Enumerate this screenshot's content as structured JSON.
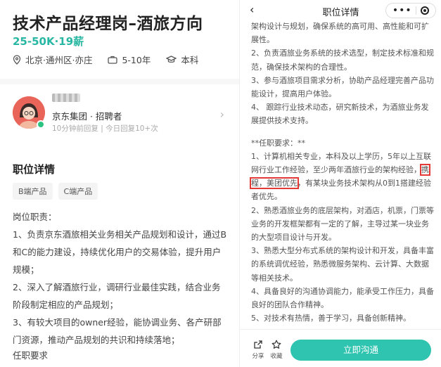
{
  "left": {
    "title": "技术产品经理岗–酒旅方向",
    "salary": "25-50K·19薪",
    "location": "北京·通州区·亦庄",
    "experience": "5-10年",
    "education": "本科",
    "recruiter_company": "京东集团 · 招聘者",
    "recruiter_status": "10分钟前回复 | 今日回复10+次",
    "section_title": "职位详情",
    "tags": [
      "B端产品",
      "C端产品"
    ],
    "body": [
      "岗位职责：",
      "1、负责京东酒旅相关业务相关产品规划和设计，通过B和C的能力建设，持续优化用户的交易体验，提升用户规模；",
      "2、深入了解酒旅行业，调研行业最佳实践，结合业务阶段制定相应的产品规划；",
      "3、有较大项目的owner经验，能协调业务、各产研部门资源，推动产品规划的共识和持续落地；"
    ],
    "req_label": "任职要求"
  },
  "right": {
    "bar_title": "职位详情",
    "pill_dots": "•••",
    "p0": "架构设计与规划，确保系统的高可用、高性能和可扩展性。",
    "p1": "2、负责酒旅业务系统的技术选型，制定技术标准和规范，确保技术架构的合理性。",
    "p2": "3、参与酒旅项目需求分析，协助产品经理完善产品功能设计，提高用户体验。",
    "p3": "4、 跟踪行业技术动态，研究新技术，为酒旅业务发展提供技术支持。",
    "req_title": "**任职要求：**",
    "r1a": "1、计算机相关专业，本科及以上学历，5年以上互联网行业工作经验，至少两年酒旅行业的架构经验，",
    "r1b": "携",
    "r1c": "程，美团优先",
    "r1d": "，有某块业务技术架构从0到1搭建经验者优先。",
    "r2": "2、熟悉酒旅业务的底层架构，对酒店，机票，门票等业务的开发框架都有一定的了解，主导过某一块业务的大型项目设计与开发。",
    "r3": "3、熟悉大型分布式系统的架构设计和开发，具备丰富的系统调优经验，熟悉微服务架构、云计算、大数据等相关技术。",
    "r4": "4、具备良好的沟通协调能力，能承受工作压力，具备良好的团队合作精神。",
    "r5": "5、对技术有热情，善于学习，具备创新精神。",
    "share_label": "分享",
    "fav_label": "收藏",
    "cta_label": "立即沟通"
  },
  "colors": {
    "accent": "#2ec4b0",
    "salary": "#28b7a3",
    "highlight": "#e53935"
  }
}
